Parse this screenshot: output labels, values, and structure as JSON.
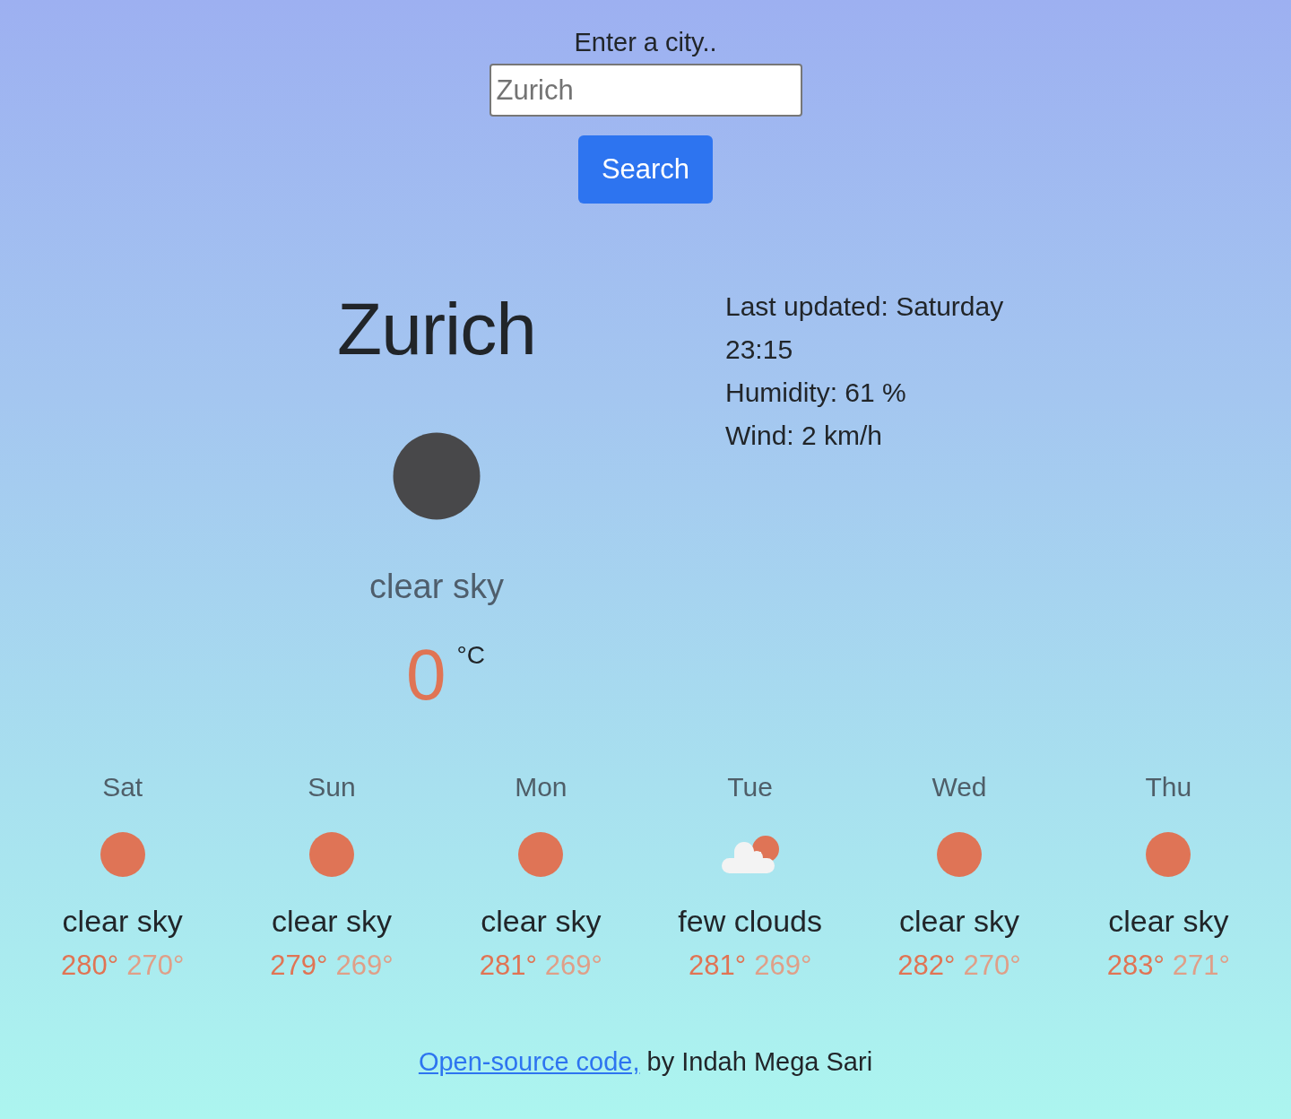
{
  "search": {
    "label": "Enter a city..",
    "placeholder": "Zurich",
    "button": "Search"
  },
  "current": {
    "city": "Zurich",
    "kind": "clear-night",
    "description": "clear sky",
    "temperature": "0",
    "unit": "°C"
  },
  "details": [
    "Last updated: Saturday 23:15",
    "Humidity: 61 %",
    "Wind: 2 km/h"
  ],
  "forecast": [
    {
      "day": "Sat",
      "kind": "clear",
      "description": "clear sky",
      "max": "280°",
      "min": "270°"
    },
    {
      "day": "Sun",
      "kind": "clear",
      "description": "clear sky",
      "max": "279°",
      "min": "269°"
    },
    {
      "day": "Mon",
      "kind": "clear",
      "description": "clear sky",
      "max": "281°",
      "min": "269°"
    },
    {
      "day": "Tue",
      "kind": "few-clouds",
      "description": "few clouds",
      "max": "281°",
      "min": "269°"
    },
    {
      "day": "Wed",
      "kind": "clear",
      "description": "clear sky",
      "max": "282°",
      "min": "270°"
    },
    {
      "day": "Thu",
      "kind": "clear",
      "description": "clear sky",
      "max": "283°",
      "min": "271°"
    }
  ],
  "footer": {
    "link": "Open-source code,",
    "text": "by Indah Mega Sari"
  }
}
